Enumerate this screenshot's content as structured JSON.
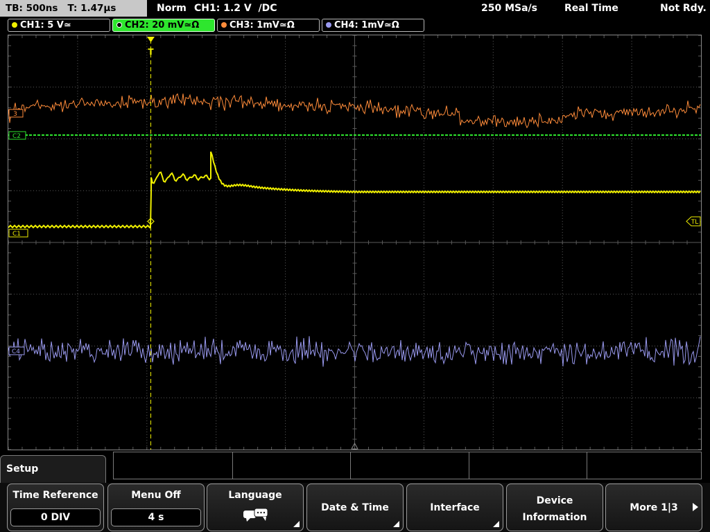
{
  "status": {
    "timebase": "TB: 500ns   T: 1.47µs",
    "mode": "Norm",
    "trigger": "CH1: 1.2 V  ∕DC",
    "sample_rate": "250 MSa/s",
    "acquisition": "Real Time",
    "state": "Not Rdy."
  },
  "channels": [
    {
      "label": "CH1: 5 V≃",
      "color": "#f0f000"
    },
    {
      "label": "CH2: 20 mV≃Ω",
      "color": "#2ee62e"
    },
    {
      "label": "CH3: 1mV≃Ω",
      "color": "#ff8c3a"
    },
    {
      "label": "CH4: 1mV≃Ω",
      "color": "#9a9af0"
    }
  ],
  "markers": {
    "ch3": "3",
    "ch2": "C2",
    "ch1": "C1",
    "ch4": "C4",
    "trigger_level": "TL",
    "trigger_pos": "T"
  },
  "menu": {
    "title": "Setup",
    "softkeys": [
      {
        "label": "Time Reference",
        "value": "0 DIV"
      },
      {
        "label": "Menu Off",
        "value": "4 s"
      },
      {
        "label": "Language",
        "icon": "speech-bubbles-icon"
      },
      {
        "label": "Date & Time"
      },
      {
        "label": "Interface"
      },
      {
        "label_line1": "Device",
        "label_line2": "Information"
      },
      {
        "label": "More 1|3"
      }
    ]
  },
  "colors": {
    "ch1": "#f0f000",
    "ch2": "#2ee62e",
    "ch3": "#ff8c3a",
    "ch4": "#9a9af0",
    "grid": "#5a5a5a",
    "trigger_marker": "#f0f000"
  }
}
